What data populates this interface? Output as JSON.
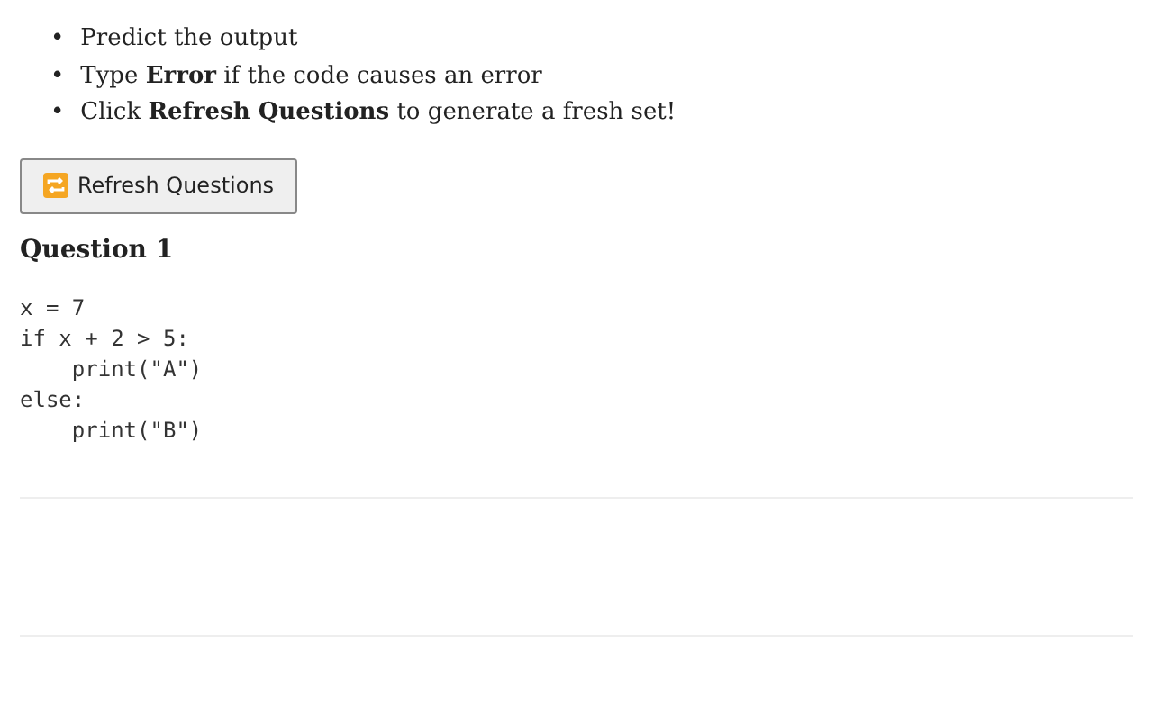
{
  "instructions": [
    {
      "marker": "•",
      "text": "Predict the output"
    },
    {
      "marker": "•",
      "text": "Type **Error** if the code causes an error"
    },
    {
      "marker": "•",
      "text": "Click **Refresh Questions** to generate a fresh set!"
    }
  ],
  "refresh_button": {
    "label": "Refresh Questions"
  },
  "questions": [
    {
      "title": "Question 1",
      "code": "x = 7\nif x + 2 > 5:\n    print(\"A\")\nelse:\n    print(\"B\")"
    }
  ]
}
